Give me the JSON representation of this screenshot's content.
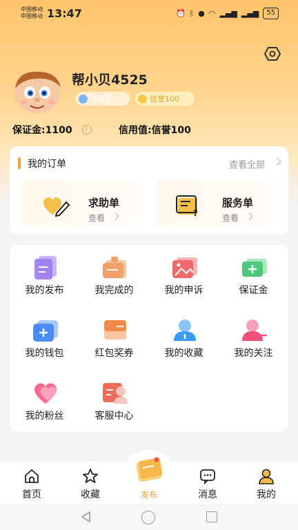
{
  "status_bar": {
    "carrier1": "中国移动",
    "carrier2": "中国移动",
    "time": "13:47",
    "battery": "55"
  },
  "profile": {
    "name": "帮小贝4525",
    "badge_verified": "已实名",
    "badge_credit": "信誉100",
    "deposit": "保证金:1100",
    "credit_value": "信用值:信誉100"
  },
  "orders": {
    "title": "我的订单",
    "view_all": "查看全部",
    "tiles": [
      {
        "title": "求助单",
        "sub": "查看"
      },
      {
        "title": "服务单",
        "sub": "查看"
      }
    ]
  },
  "grid": [
    {
      "label": "我的发布",
      "icon": "publish-doc-icon",
      "color": "#9b7cf0"
    },
    {
      "label": "我完成的",
      "icon": "completed-box-icon",
      "color": "#f0a06a"
    },
    {
      "label": "我的申诉",
      "icon": "appeal-image-icon",
      "color": "#ef6b6b"
    },
    {
      "label": "保证金",
      "icon": "deposit-wallet-icon",
      "color": "#4cc97a"
    },
    {
      "label": "我的钱包",
      "icon": "wallet-icon",
      "color": "#4b8cf5"
    },
    {
      "label": "红包奖券",
      "icon": "red-packet-icon",
      "color": "#f5894a"
    },
    {
      "label": "我的收藏",
      "icon": "favorites-person-icon",
      "color": "#3a9cf0"
    },
    {
      "label": "我的关注",
      "icon": "follow-person-icon",
      "color": "#f0507a"
    },
    {
      "label": "我的粉丝",
      "icon": "heart-icon",
      "color": "#f56b8f"
    },
    {
      "label": "客服中心",
      "icon": "customer-service-icon",
      "color": "#ef6b5a"
    }
  ],
  "tabbar": {
    "tabs": [
      {
        "label": "首页",
        "icon": "home-icon"
      },
      {
        "label": "收藏",
        "icon": "star-icon"
      },
      {
        "label": "消息",
        "icon": "message-icon"
      },
      {
        "label": "我的",
        "icon": "profile-icon"
      }
    ],
    "publish": {
      "label": "发布",
      "icon": "publish-note-icon"
    }
  },
  "colors": {
    "accent": "#f2a43a",
    "hero_top": "#ffc46b",
    "publish_label": "#e3a23b"
  }
}
